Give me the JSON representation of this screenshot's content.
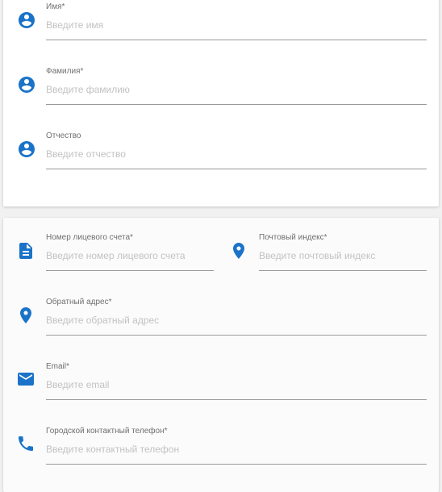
{
  "colors": {
    "icon": "#1a73c8",
    "underline": "#9a9a9a",
    "label": "#6f6f6f",
    "placeholder": "#c2c2c2"
  },
  "personal": {
    "last_name": {
      "label": "Имя*",
      "placeholder": "Введите имя",
      "icon": "account-circle-icon"
    },
    "first_name": {
      "label": "Фамилия*",
      "placeholder": "Введите фамилию",
      "icon": "account-circle-icon"
    },
    "patronymic": {
      "label": "Отчество",
      "placeholder": "Введите отчество",
      "icon": "account-circle-icon"
    }
  },
  "contact": {
    "account": {
      "label": "Номер лицевого счета*",
      "placeholder": "Введите номер лицевого счета",
      "icon": "document-icon"
    },
    "postal": {
      "label": "Почтовый индекс*",
      "placeholder": "Введите почтовый индекс",
      "icon": "location-pin-icon"
    },
    "address": {
      "label": "Обратный адрес*",
      "placeholder": "Введите обратный адрес",
      "icon": "location-pin-icon"
    },
    "email": {
      "label": "Email*",
      "placeholder": "Введите email",
      "icon": "email-icon"
    },
    "phone": {
      "label": "Городской контактный телефон*",
      "placeholder": "Введите контактный телефон",
      "icon": "phone-icon"
    }
  }
}
